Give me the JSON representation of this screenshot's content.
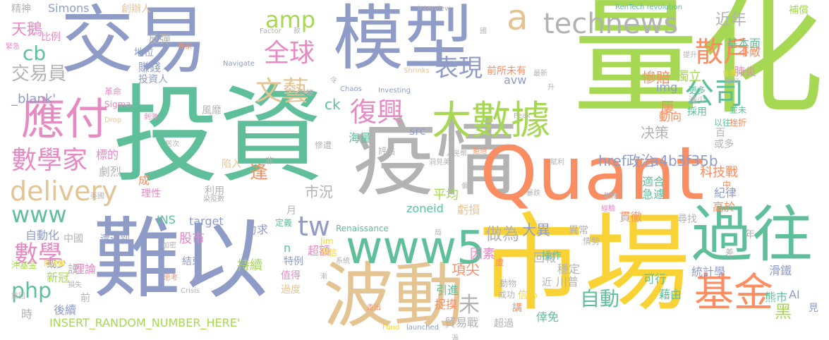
{
  "palette": {
    "blue": "#8f9cc7",
    "green": "#5fbf9a",
    "lime": "#a6d854",
    "orange": "#fb8d62",
    "gold": "#f9d335",
    "pink": "#e78ac3",
    "tan": "#e5c494",
    "gray": "#b3b3b3"
  },
  "words": [
    {
      "text": "量化",
      "color": "lime"
    },
    {
      "text": "投資",
      "color": "green"
    },
    {
      "text": "交易",
      "color": "blue"
    },
    {
      "text": "模型",
      "color": "blue"
    },
    {
      "text": "難以",
      "color": "blue"
    },
    {
      "text": "疫情",
      "color": "gray"
    },
    {
      "text": "市場",
      "color": "gold"
    },
    {
      "text": "Quant",
      "color": "orange"
    },
    {
      "text": "波動",
      "color": "tan"
    },
    {
      "text": "過往",
      "color": "green"
    },
    {
      "text": "大數據",
      "color": "lime"
    },
    {
      "text": "應付",
      "color": "pink"
    },
    {
      "text": "www5",
      "color": "green"
    },
    {
      "text": "基金",
      "color": "orange"
    },
    {
      "text": "technews",
      "color": "gray"
    },
    {
      "text": "復興",
      "color": "pink"
    },
    {
      "text": "數學家",
      "color": "pink"
    },
    {
      "text": "delivery",
      "color": "tan"
    },
    {
      "text": "amp",
      "color": "lime"
    },
    {
      "text": "全球",
      "color": "pink"
    },
    {
      "text": "表現",
      "color": "blue"
    },
    {
      "text": "文藝",
      "color": "tan"
    },
    {
      "text": "公司",
      "color": "green"
    },
    {
      "text": "散戶",
      "color": "orange"
    },
    {
      "text": "a",
      "color": "tan"
    },
    {
      "text": "cb",
      "color": "green"
    },
    {
      "text": "交易員",
      "color": "gray"
    },
    {
      "text": "www",
      "color": "green"
    },
    {
      "text": "tw",
      "color": "blue"
    },
    {
      "text": "數學",
      "color": "pink"
    },
    {
      "text": "php",
      "color": "green"
    },
    {
      "text": "自動",
      "color": "green"
    },
    {
      "text": "未",
      "color": "gray"
    },
    {
      "text": "項尖",
      "color": "orange"
    },
    {
      "text": "大異",
      "color": "blue"
    },
    {
      "text": "ck",
      "color": "green"
    },
    {
      "text": "天鵝",
      "color": "pink"
    },
    {
      "text": "近年",
      "color": "gray"
    },
    {
      "text": "獨立",
      "color": "lime"
    },
    {
      "text": "慘賠",
      "color": "orange"
    },
    {
      "text": "基本面",
      "color": "green"
    },
    {
      "text": "不敵",
      "color": "orange"
    },
    {
      "text": "肺炎",
      "color": "pink"
    },
    {
      "text": "决策",
      "color": "gray"
    },
    {
      "text": "屢",
      "color": "orange"
    },
    {
      "text": "動向",
      "color": "orange"
    },
    {
      "text": "href政治",
      "color": "blue"
    },
    {
      "text": "a4b3f35b",
      "color": "blue"
    },
    {
      "text": "科技戰",
      "color": "orange"
    },
    {
      "text": "逢",
      "color": "orange"
    },
    {
      "text": "適合",
      "color": "green"
    },
    {
      "text": "急遽",
      "color": "green"
    },
    {
      "text": "紀律",
      "color": "blue"
    },
    {
      "text": "高於",
      "color": "orange"
    },
    {
      "text": "zoneid",
      "color": "green"
    },
    {
      "text": "市況",
      "color": "gray"
    },
    {
      "text": "做為",
      "color": "gray"
    },
    {
      "text": "平均",
      "color": "lime"
    },
    {
      "text": "虧損",
      "color": "tan"
    },
    {
      "text": "力求",
      "color": "blue"
    },
    {
      "text": "target",
      "color": "blue"
    },
    {
      "text": "股市",
      "color": "pink"
    },
    {
      "text": "理論",
      "color": "pink"
    },
    {
      "text": "持續",
      "color": "lime"
    },
    {
      "text": "超額",
      "color": "pink"
    },
    {
      "text": "因素",
      "color": "pink"
    },
    {
      "text": "回報",
      "color": "gray"
    },
    {
      "text": "穩定",
      "color": "gray"
    },
    {
      "text": "可行",
      "color": "green"
    },
    {
      "text": "藉由",
      "color": "green"
    },
    {
      "text": "統計學",
      "color": "blue"
    },
    {
      "text": "滑鐵",
      "color": "blue"
    },
    {
      "text": "熊市",
      "color": "green"
    },
    {
      "text": "黑",
      "color": "lime"
    },
    {
      "text": "AI",
      "color": "blue"
    },
    {
      "text": "引進",
      "color": "green"
    },
    {
      "text": "捉摸",
      "color": "orange"
    },
    {
      "text": "貿易戰",
      "color": "gray"
    },
    {
      "text": "倖免",
      "color": "green"
    },
    {
      "text": "INSERT_RANDOM_NUMBER_HERE'",
      "color": "lime"
    },
    {
      "text": "自動化",
      "color": "blue"
    },
    {
      "text": "INS",
      "color": "green"
    },
    {
      "text": "n",
      "color": "green"
    },
    {
      "text": "説",
      "color": "gray"
    },
    {
      "text": "前",
      "color": "gray"
    },
    {
      "text": "新冠",
      "color": "lime"
    },
    {
      "text": "後續",
      "color": "blue"
    },
    {
      "text": "時",
      "color": "gray"
    },
    {
      "text": "過度",
      "color": "tan"
    },
    {
      "text": "值得",
      "color": "pink"
    },
    {
      "text": "結束",
      "color": "blue"
    },
    {
      "text": "特例",
      "color": "blue"
    },
    {
      "text": "Renaissance",
      "color": "green"
    },
    {
      "text": "操作",
      "color": "green"
    },
    {
      "text": "貫徹",
      "color": "orange"
    },
    {
      "text": "尋找",
      "color": "gray"
    },
    {
      "text": "異常",
      "color": "gray"
    },
    {
      "text": "情勢",
      "color": "gray"
    },
    {
      "text": "成功",
      "color": "gray"
    },
    {
      "text": "動物",
      "color": "gray"
    },
    {
      "text": "信心",
      "color": "gold"
    },
    {
      "text": "近",
      "color": "gray"
    },
    {
      "text": "川普",
      "color": "gray"
    },
    {
      "text": "講",
      "color": "orange"
    },
    {
      "text": "超過",
      "color": "gray"
    },
    {
      "text": "賺錢",
      "color": "blue"
    },
    {
      "text": "投資人",
      "color": "blue"
    },
    {
      "text": "地位",
      "color": "blue"
    },
    {
      "text": "反彈",
      "color": "gray"
    },
    {
      "text": "比例",
      "color": "pink"
    },
    {
      "text": "標的",
      "color": "pink"
    },
    {
      "text": "劇烈",
      "color": "gray"
    },
    {
      "text": "理性",
      "color": "pink"
    },
    {
      "text": "成",
      "color": "orange"
    },
    {
      "text": "或少",
      "color": "blue"
    },
    {
      "text": "中國",
      "color": "gray"
    },
    {
      "text": "遭遇到",
      "color": "blue"
    },
    {
      "text": "利用",
      "color": "gray"
    },
    {
      "text": "陷入",
      "color": "tan"
    },
    {
      "text": "風靡",
      "color": "gray"
    },
    {
      "text": "_blank'",
      "color": "blue"
    },
    {
      "text": "img",
      "color": "blue"
    },
    {
      "text": "src",
      "color": "blue"
    },
    {
      "text": "avw",
      "color": "blue"
    },
    {
      "text": "海量",
      "color": "green"
    },
    {
      "text": "採用",
      "color": "green"
    },
    {
      "text": "減少",
      "color": "gray"
    },
    {
      "text": "更多",
      "color": "green"
    },
    {
      "text": "前所未有",
      "color": "orange"
    },
    {
      "text": "Simons",
      "color": "blue"
    },
    {
      "text": "創辦人",
      "color": "tan"
    },
    {
      "text": "精神",
      "color": "gray"
    },
    {
      "text": "補償",
      "color": "lime"
    },
    {
      "text": "RenTech revolution",
      "color": "green"
    },
    {
      "text": "interview",
      "color": "gray"
    },
    {
      "text": "Navigate",
      "color": "blue"
    },
    {
      "text": "Shrinks",
      "color": "tan"
    },
    {
      "text": "Investing",
      "color": "blue"
    },
    {
      "text": "Chaos",
      "color": "blue"
    },
    {
      "text": "Sigma",
      "color": "pink"
    },
    {
      "text": "Drop",
      "color": "tan"
    },
    {
      "text": "Factor",
      "color": "gray"
    },
    {
      "text": "Peak",
      "color": "gray"
    },
    {
      "text": "Jim",
      "color": "gold"
    },
    {
      "text": "深信",
      "color": "gold"
    },
    {
      "text": "Fund",
      "color": "gold"
    },
    {
      "text": "launched",
      "color": "blue"
    },
    {
      "text": "Crisis",
      "color": "gray"
    },
    {
      "text": "革命",
      "color": "pink"
    },
    {
      "text": "慘遭",
      "color": "gray"
    },
    {
      "text": "定義",
      "color": "green"
    },
    {
      "text": "沖基金",
      "color": "lime"
    },
    {
      "text": "評估",
      "color": "gray"
    },
    {
      "text": "或多",
      "color": "gray"
    },
    {
      "text": "年",
      "color": "gray"
    },
    {
      "text": "見",
      "color": "blue"
    },
    {
      "text": "百",
      "color": "gray"
    },
    {
      "text": "以往",
      "color": "green"
    },
    {
      "text": "並未",
      "color": "green"
    },
    {
      "text": "挫折",
      "color": "orange"
    },
    {
      "text": "加密",
      "color": "gray"
    },
    {
      "text": "美國",
      "color": "gray"
    },
    {
      "text": "財政部",
      "color": "gold"
    },
    {
      "text": "染疫數",
      "color": "gray"
    },
    {
      "text": "居次",
      "color": "gray"
    },
    {
      "text": "刺激",
      "color": "pink"
    },
    {
      "text": "非",
      "color": "gray"
    },
    {
      "text": "思考",
      "color": "orange"
    },
    {
      "text": "系統",
      "color": "gray"
    },
    {
      "text": "損失",
      "color": "gray"
    },
    {
      "text": "重回",
      "color": "gray"
    },
    {
      "text": "走出",
      "color": "orange"
    },
    {
      "text": "虛",
      "color": "orange"
    },
    {
      "text": "差",
      "color": "gray"
    },
    {
      "text": "中",
      "color": "orange"
    },
    {
      "text": "月",
      "color": "gray"
    },
    {
      "text": "升",
      "color": "gray"
    },
    {
      "text": "提升",
      "color": "gray"
    },
    {
      "text": "升幅",
      "color": "gray"
    },
    {
      "text": "專家",
      "color": "orange"
    },
    {
      "text": "人民幣",
      "color": "gray"
    },
    {
      "text": "拒絕",
      "color": "orange"
    },
    {
      "text": "洞見美",
      "color": "gray"
    },
    {
      "text": "緊急",
      "color": "pink"
    },
    {
      "text": "暴跌",
      "color": "gray"
    },
    {
      "text": "經驗",
      "color": "pink"
    },
    {
      "text": "最新",
      "color": "gray"
    },
    {
      "text": "令",
      "color": "gray"
    },
    {
      "text": "局",
      "color": "gray"
    },
    {
      "text": "款",
      "color": "gray"
    },
    {
      "text": "偏",
      "color": "gray"
    },
    {
      "text": "漸",
      "color": "gray"
    },
    {
      "text": "渦",
      "color": "gray"
    },
    {
      "text": "金價",
      "color": "gold"
    },
    {
      "text": "預料",
      "color": "gray"
    },
    {
      "text": "賦利",
      "color": "gray"
    },
    {
      "text": "國",
      "color": "gray"
    },
    {
      "text": "猶豫",
      "color": "gray"
    }
  ]
}
